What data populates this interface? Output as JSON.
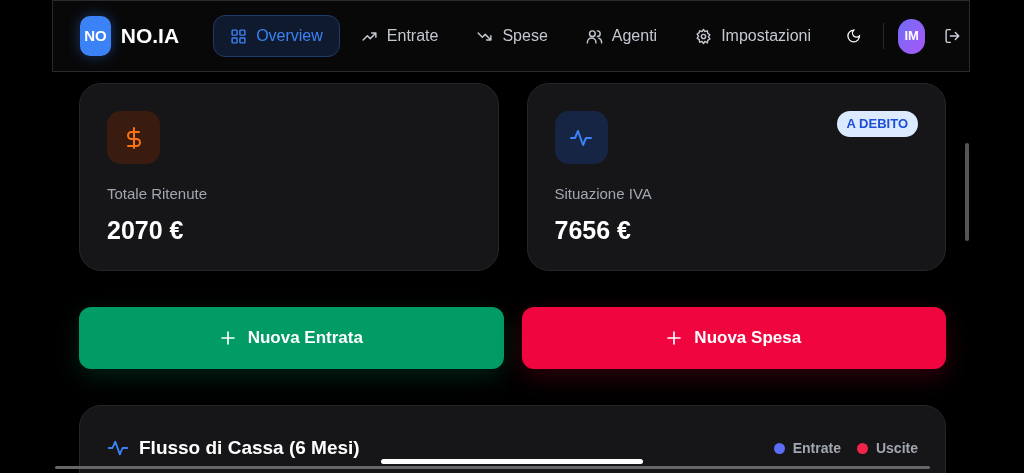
{
  "brand": {
    "logo": "NO",
    "name": "NO.IA"
  },
  "nav": [
    {
      "label": "Overview",
      "selected": true
    },
    {
      "label": "Entrate",
      "selected": false
    },
    {
      "label": "Spese",
      "selected": false
    },
    {
      "label": "Agenti",
      "selected": false
    },
    {
      "label": "Impostazioni",
      "selected": false
    }
  ],
  "user": {
    "initials": "IM"
  },
  "cards": [
    {
      "kind": "ritenute",
      "label": "Totale Ritenute",
      "value": "2070 €"
    },
    {
      "kind": "iva",
      "label": "Situazione IVA",
      "value": "7656 €",
      "badge": "A DEBITO"
    }
  ],
  "actions": [
    {
      "kind": "income",
      "label": "Nuova Entrata"
    },
    {
      "kind": "expense",
      "label": "Nuova Spesa"
    }
  ],
  "cash_flow": {
    "title": "Flusso di Cassa (6 Mesi)",
    "legend": [
      {
        "label": "Entrate",
        "color": "#5b6cf5"
      },
      {
        "label": "Uscite",
        "color": "#f0234d"
      }
    ]
  }
}
